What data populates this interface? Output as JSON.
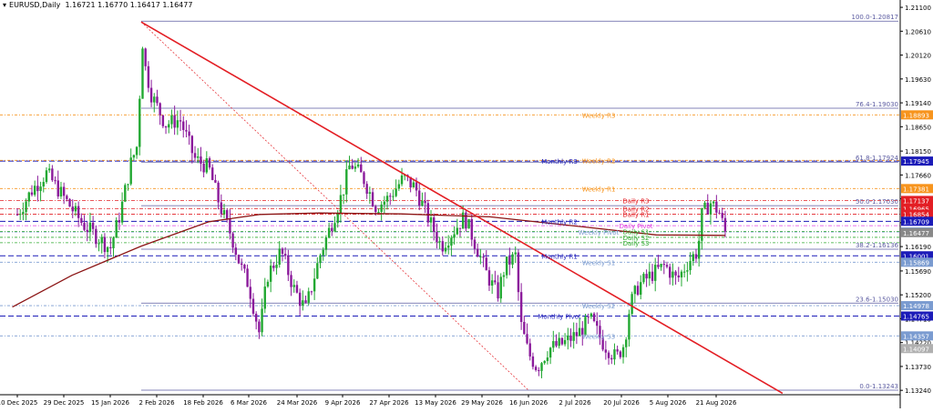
{
  "header": {
    "symbol_label": "EURUSD,Daily",
    "ohlc": "1.16721 1.16770 1.16417 1.16477",
    "collapse_icon": "triangle-down-icon"
  },
  "colors": {
    "up": "#22a832",
    "down": "#8b1a9b",
    "trendline": "#e31e24",
    "ma": "#8b1414",
    "fib": "#5a5aa0",
    "weekly": "#f7941d",
    "monthly": "#1b1bb8",
    "daily_r": "#e31e24",
    "daily_pivot": "#e040e0",
    "daily_s": "#2ea82e",
    "weekly_s": "#7a9bd0",
    "price_tag": "#e31e24"
  },
  "chart_data": {
    "type": "candlestick",
    "symbol": "EURUSD",
    "timeframe": "Daily",
    "ylim": [
      1.1315,
      1.2112
    ],
    "y_ticks": [
      "1.21100",
      "1.20610",
      "1.20120",
      "1.19630",
      "1.19140",
      "1.18650",
      "1.18150",
      "1.17660",
      "1.17170",
      "1.16680",
      "1.16190",
      "1.15690",
      "1.15200",
      "1.14710",
      "1.14220",
      "1.13730",
      "1.13240"
    ],
    "x_ticks": [
      "10 Dec 2025",
      "29 Dec 2025",
      "15 Jan 2026",
      "2 Feb 2026",
      "18 Feb 2026",
      "6 Mar 2026",
      "24 Mar 2026",
      "9 Apr 2026",
      "27 Apr 2026",
      "13 May 2026",
      "29 May 2026",
      "16 Jun 2026",
      "2 Jul 2026",
      "20 Jul 2026",
      "5 Aug 2026",
      "21 Aug 2026"
    ],
    "close_path": [
      [
        "2025-12-10",
        1.1685
      ],
      [
        "2025-12-16",
        1.1735
      ],
      [
        "2025-12-22",
        1.177
      ],
      [
        "2025-12-29",
        1.172
      ],
      [
        "2026-01-05",
        1.1665
      ],
      [
        "2026-01-10",
        1.164
      ],
      [
        "2026-01-15",
        1.1615
      ],
      [
        "2026-01-19",
        1.169
      ],
      [
        "2026-01-23",
        1.179
      ],
      [
        "2026-01-26",
        1.1835
      ],
      [
        "2026-01-27",
        1.208
      ],
      [
        "2026-01-28",
        1.2
      ],
      [
        "2026-01-31",
        1.193
      ],
      [
        "2026-02-05",
        1.187
      ],
      [
        "2026-02-10",
        1.188
      ],
      [
        "2026-02-15",
        1.18
      ],
      [
        "2026-02-20",
        1.178
      ],
      [
        "2026-02-24",
        1.17
      ],
      [
        "2026-02-28",
        1.164
      ],
      [
        "2026-03-03",
        1.158
      ],
      [
        "2026-03-06",
        1.154
      ],
      [
        "2026-03-10",
        1.144
      ],
      [
        "2026-03-13",
        1.156
      ],
      [
        "2026-03-18",
        1.161
      ],
      [
        "2026-03-23",
        1.153
      ],
      [
        "2026-03-27",
        1.149
      ],
      [
        "2026-04-01",
        1.16
      ],
      [
        "2026-04-06",
        1.168
      ],
      [
        "2026-04-09",
        1.173
      ],
      [
        "2026-04-12",
        1.179
      ],
      [
        "2026-04-17",
        1.176
      ],
      [
        "2026-04-22",
        1.17
      ],
      [
        "2026-04-27",
        1.172
      ],
      [
        "2026-05-02",
        1.176
      ],
      [
        "2026-05-06",
        1.174
      ],
      [
        "2026-05-11",
        1.167
      ],
      [
        "2026-05-15",
        1.162
      ],
      [
        "2026-05-19",
        1.165
      ],
      [
        "2026-05-23",
        1.168
      ],
      [
        "2026-05-27",
        1.162
      ],
      [
        "2026-05-31",
        1.156
      ],
      [
        "2026-06-04",
        1.152
      ],
      [
        "2026-06-07",
        1.158
      ],
      [
        "2026-06-11",
        1.16
      ],
      [
        "2026-06-13",
        1.146
      ],
      [
        "2026-06-16",
        1.14
      ],
      [
        "2026-06-19",
        1.137
      ],
      [
        "2026-06-23",
        1.141
      ],
      [
        "2026-06-28",
        1.142
      ],
      [
        "2026-07-03",
        1.144
      ],
      [
        "2026-07-08",
        1.147
      ],
      [
        "2026-07-13",
        1.142
      ],
      [
        "2026-07-18",
        1.139
      ],
      [
        "2026-07-21",
        1.142
      ],
      [
        "2026-07-23",
        1.15
      ],
      [
        "2026-07-26",
        1.154
      ],
      [
        "2026-07-30",
        1.156
      ],
      [
        "2026-08-04",
        1.158
      ],
      [
        "2026-08-08",
        1.155
      ],
      [
        "2026-08-12",
        1.159
      ],
      [
        "2026-08-15",
        1.161
      ],
      [
        "2026-08-16",
        1.168
      ],
      [
        "2026-08-19",
        1.171
      ],
      [
        "2026-08-22",
        1.169
      ],
      [
        "2026-08-24",
        1.1648
      ]
    ],
    "ma_path": [
      [
        "2025-12-08",
        1.1495
      ],
      [
        "2026-01-01",
        1.156
      ],
      [
        "2026-01-27",
        1.162
      ],
      [
        "2026-02-20",
        1.167
      ],
      [
        "2026-03-10",
        1.1685
      ],
      [
        "2026-04-01",
        1.1688
      ],
      [
        "2026-05-01",
        1.1686
      ],
      [
        "2026-06-01",
        1.168
      ],
      [
        "2026-07-01",
        1.1662
      ],
      [
        "2026-08-01",
        1.1643
      ],
      [
        "2026-08-24",
        1.1642
      ]
    ],
    "trendline": {
      "from": [
        "2026-01-27",
        1.208
      ],
      "to": [
        "2026-09-12",
        1.1318
      ]
    },
    "fib_diagonal": {
      "from": [
        "2026-01-27",
        1.208
      ],
      "to": [
        "2026-06-16",
        1.13243
      ]
    },
    "fib_levels": [
      {
        "label": "100.0-1.20817",
        "value": 1.20817
      },
      {
        "label": "76.4-1.19030",
        "value": 1.1903
      },
      {
        "label": "61.8-1.17924",
        "value": 1.17924
      },
      {
        "label": "50.0-1.17030",
        "value": 1.1703
      },
      {
        "label": "38.2-1.16136",
        "value": 1.16136
      },
      {
        "label": "23.6-1.15030",
        "value": 1.1503
      },
      {
        "label": "0.0-1.13243",
        "value": 1.13243
      }
    ],
    "pivot_lines": [
      {
        "label": "Weekly R3",
        "value": 1.18893,
        "tag": "1.18893",
        "group": "weekly"
      },
      {
        "label": "Monthly R3",
        "value": 1.17945,
        "tag": "1.17945",
        "group": "monthly"
      },
      {
        "label": "Weekly R2",
        "value": 1.1796,
        "tag": "",
        "group": "weekly"
      },
      {
        "label": "Weekly R1",
        "value": 1.17381,
        "tag": "1.17381",
        "group": "weekly"
      },
      {
        "label": "Daily R3",
        "value": 1.17137,
        "tag": "1.17137",
        "group": "daily_r"
      },
      {
        "label": "Daily R2",
        "value": 1.16965,
        "tag": "1.16965",
        "group": "daily_r"
      },
      {
        "label": "Daily R1",
        "value": 1.16854,
        "tag": "1.16854",
        "group": "daily_r"
      },
      {
        "label": "Monthly R2",
        "value": 1.16709,
        "tag": "1.16709",
        "group": "monthly"
      },
      {
        "label": "Daily Pivot",
        "value": 1.1662,
        "tag": "",
        "group": "daily_pivot"
      },
      {
        "label": "Weekly Pivot",
        "value": 1.1649,
        "tag": "1.16490",
        "group": "weekly_s"
      },
      {
        "label": "Daily S1",
        "value": 1.165,
        "tag": "",
        "group": "daily_s"
      },
      {
        "label": "Daily S2",
        "value": 1.1638,
        "tag": "",
        "group": "daily_s"
      },
      {
        "label": "Daily S3",
        "value": 1.1627,
        "tag": "",
        "group": "daily_s"
      },
      {
        "label": "Monthly R1",
        "value": 1.16001,
        "tag": "1.16001",
        "group": "monthly"
      },
      {
        "label": "Weekly S1",
        "value": 1.15869,
        "tag": "1.15869",
        "group": "weekly_s"
      },
      {
        "label": "Weekly S2",
        "value": 1.14978,
        "tag": "1.14978",
        "group": "weekly_s"
      },
      {
        "label": "Monthly Pivot",
        "value": 1.14765,
        "tag": "1.14765",
        "group": "monthly"
      },
      {
        "label": "Weekly S3",
        "value": 1.14357,
        "tag": "1.14357",
        "group": "weekly_s"
      }
    ],
    "current_price": {
      "value": 1.16477,
      "tag": "1.16477"
    },
    "grey_tag": {
      "value": 1.14097,
      "tag": "1.14097"
    }
  }
}
